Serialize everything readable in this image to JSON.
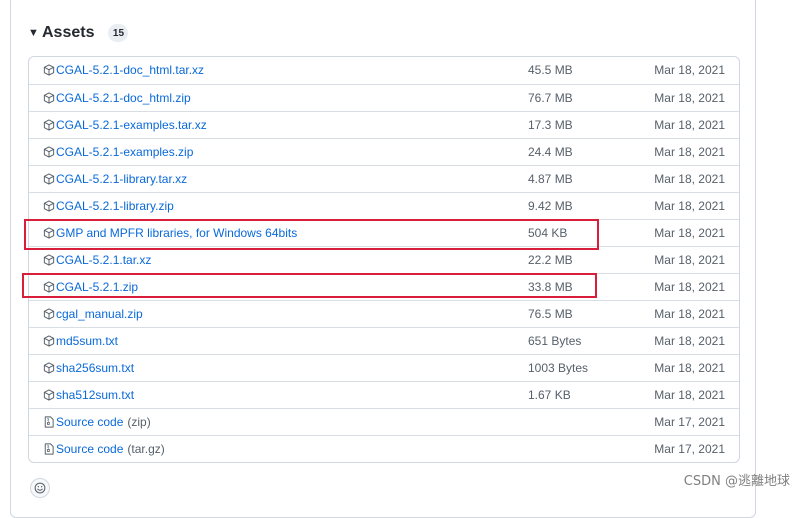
{
  "assets": {
    "title": "Assets",
    "count": "15",
    "items": [
      {
        "name": "CGAL-5.2.1-doc_html.tar.xz",
        "ext": "",
        "size": "45.5 MB",
        "date": "Mar 18, 2021",
        "icon": "package-icon"
      },
      {
        "name": "CGAL-5.2.1-doc_html.zip",
        "ext": "",
        "size": "76.7 MB",
        "date": "Mar 18, 2021",
        "icon": "package-icon"
      },
      {
        "name": "CGAL-5.2.1-examples.tar.xz",
        "ext": "",
        "size": "17.3 MB",
        "date": "Mar 18, 2021",
        "icon": "package-icon"
      },
      {
        "name": "CGAL-5.2.1-examples.zip",
        "ext": "",
        "size": "24.4 MB",
        "date": "Mar 18, 2021",
        "icon": "package-icon"
      },
      {
        "name": "CGAL-5.2.1-library.tar.xz",
        "ext": "",
        "size": "4.87 MB",
        "date": "Mar 18, 2021",
        "icon": "package-icon"
      },
      {
        "name": "CGAL-5.2.1-library.zip",
        "ext": "",
        "size": "9.42 MB",
        "date": "Mar 18, 2021",
        "icon": "package-icon"
      },
      {
        "name": "GMP and MPFR libraries, for Windows 64bits",
        "ext": "",
        "size": "504 KB",
        "date": "Mar 18, 2021",
        "icon": "package-icon"
      },
      {
        "name": "CGAL-5.2.1.tar.xz",
        "ext": "",
        "size": "22.2 MB",
        "date": "Mar 18, 2021",
        "icon": "package-icon"
      },
      {
        "name": "CGAL-5.2.1.zip",
        "ext": "",
        "size": "33.8 MB",
        "date": "Mar 18, 2021",
        "icon": "package-icon"
      },
      {
        "name": "cgal_manual.zip",
        "ext": "",
        "size": "76.5 MB",
        "date": "Mar 18, 2021",
        "icon": "package-icon"
      },
      {
        "name": "md5sum.txt",
        "ext": "",
        "size": "651 Bytes",
        "date": "Mar 18, 2021",
        "icon": "package-icon"
      },
      {
        "name": "sha256sum.txt",
        "ext": "",
        "size": "1003 Bytes",
        "date": "Mar 18, 2021",
        "icon": "package-icon"
      },
      {
        "name": "sha512sum.txt",
        "ext": "",
        "size": "1.67 KB",
        "date": "Mar 18, 2021",
        "icon": "package-icon"
      },
      {
        "name": "Source code",
        "ext": "(zip)",
        "size": "",
        "date": "Mar 17, 2021",
        "icon": "file-zip-icon"
      },
      {
        "name": "Source code",
        "ext": "(tar.gz)",
        "size": "",
        "date": "Mar 17, 2021",
        "icon": "file-zip-icon"
      }
    ]
  },
  "colors": {
    "link": "#0969da",
    "muted": "#57606a",
    "highlight": "#d81e3a",
    "border": "#d0d7de"
  },
  "watermark": "CSDN @逃離地球"
}
